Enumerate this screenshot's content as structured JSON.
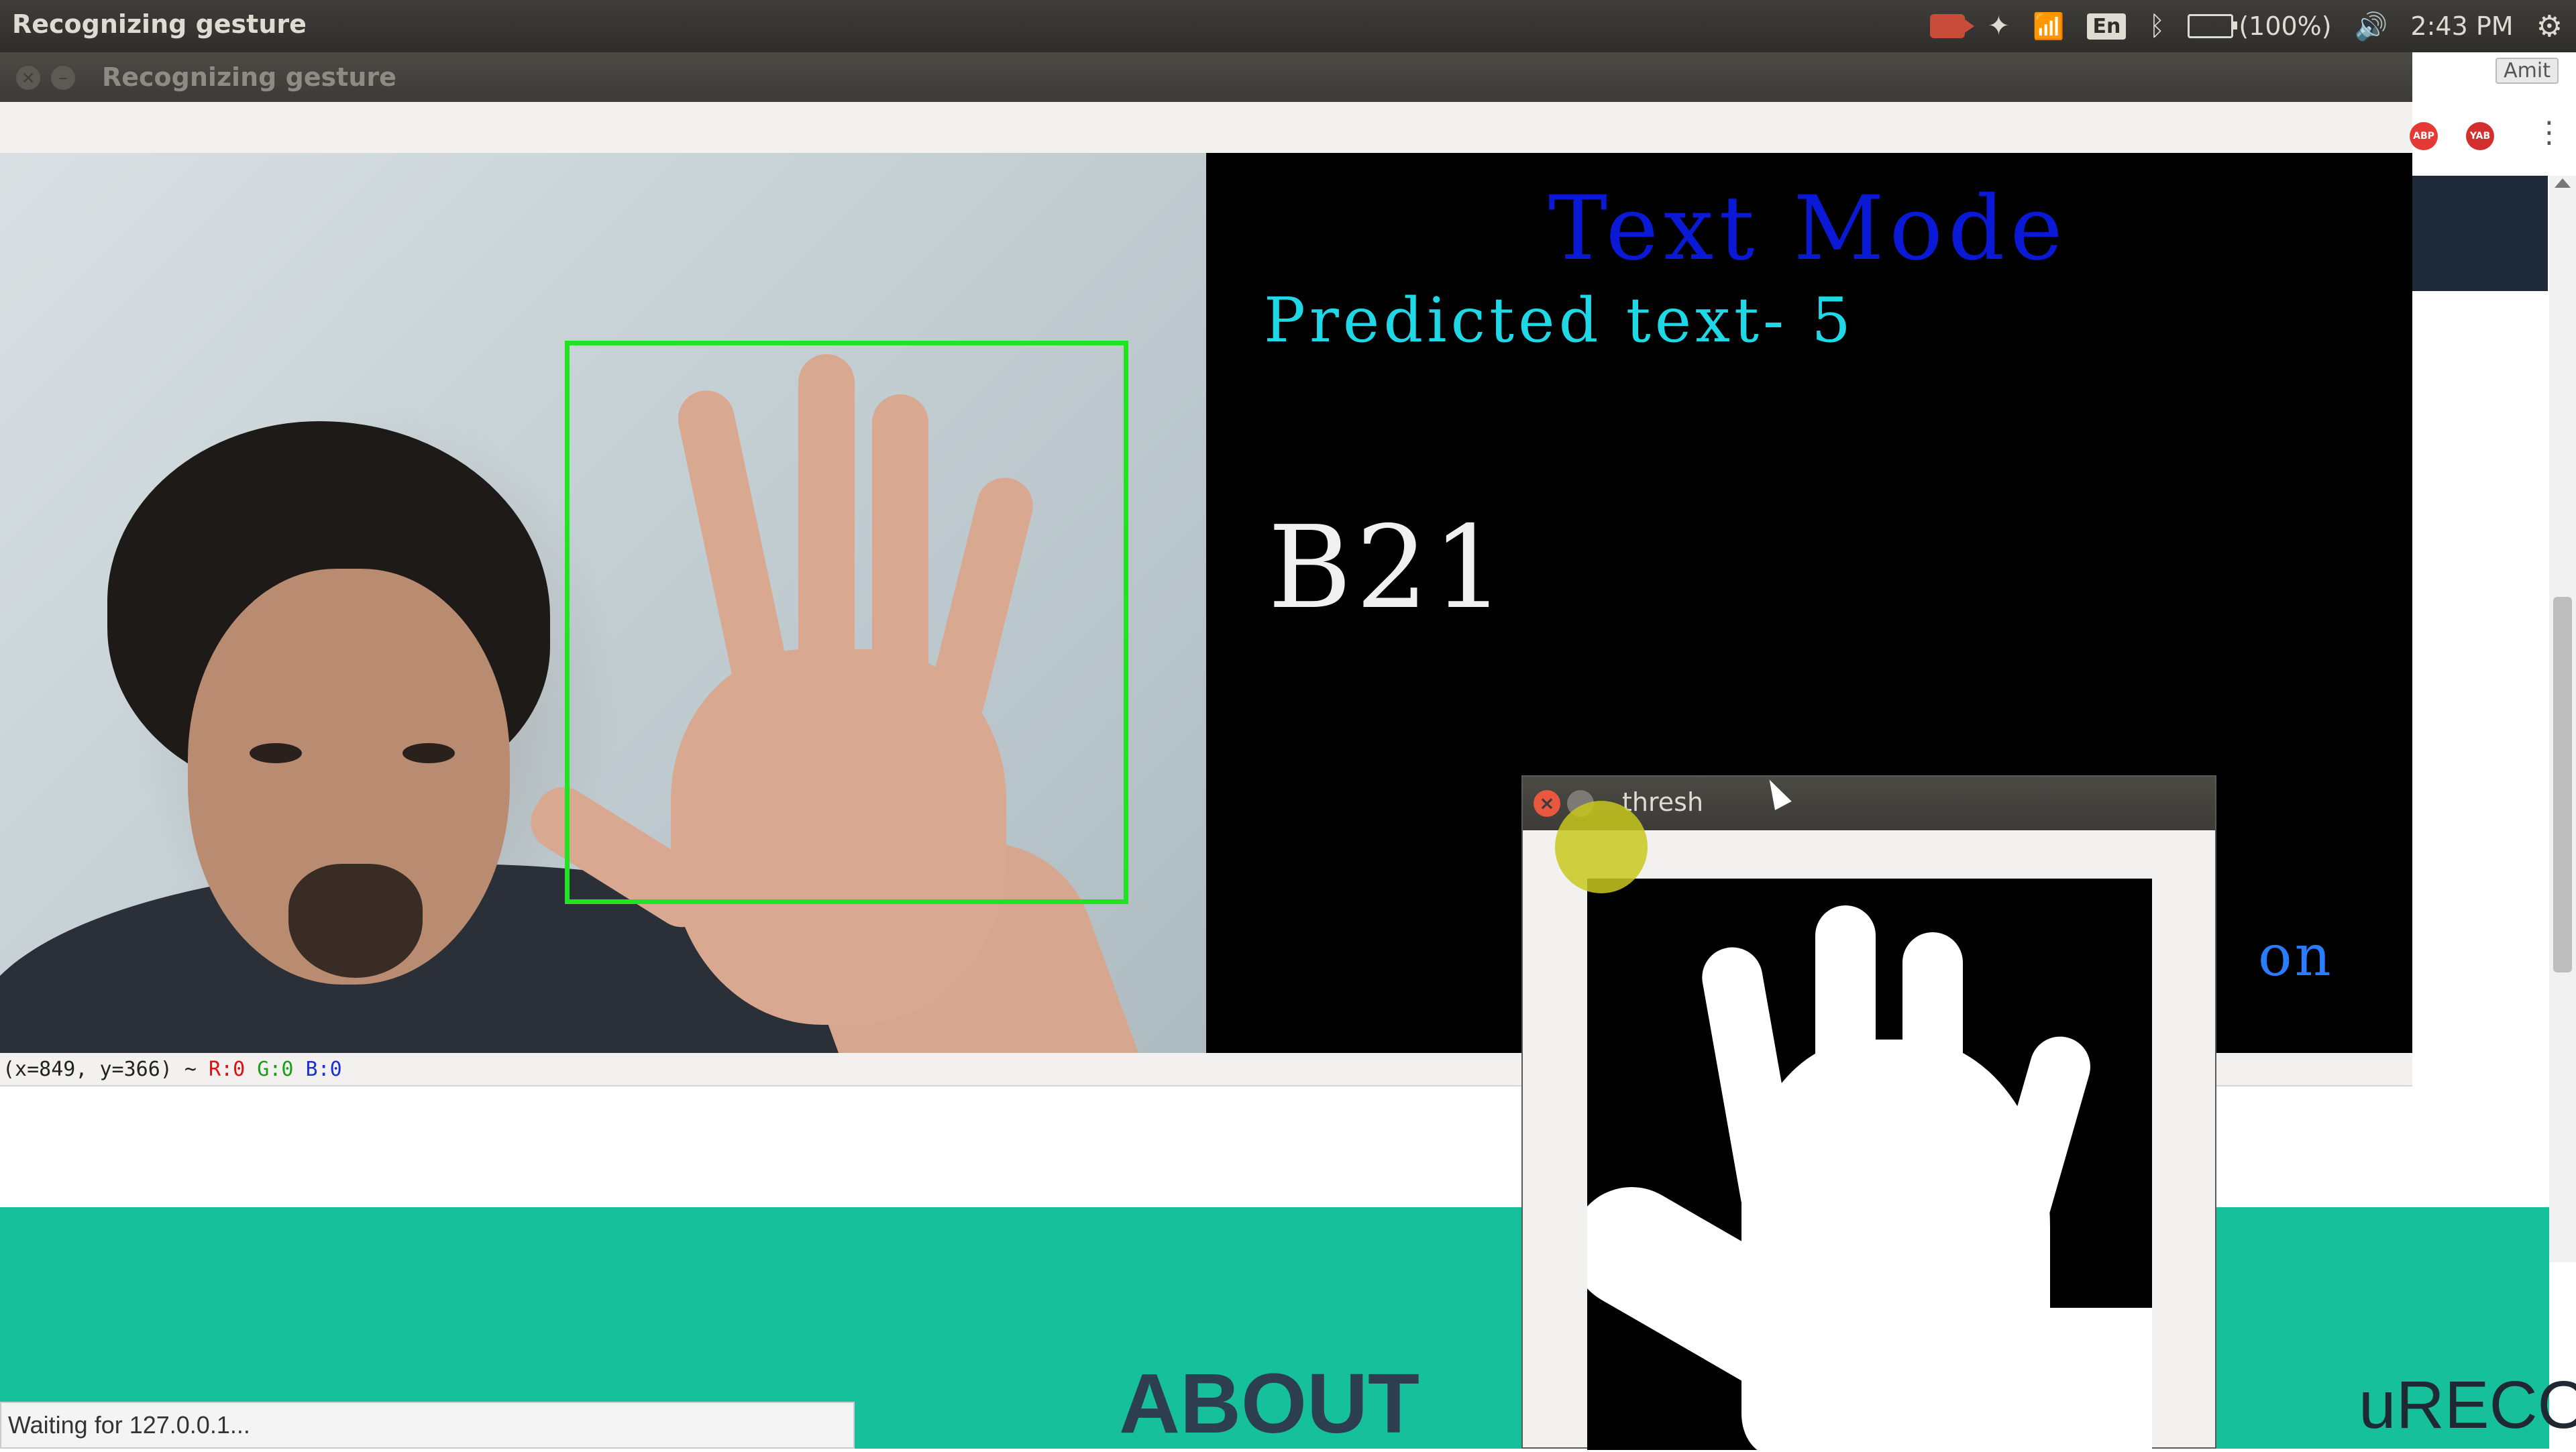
{
  "topbar": {
    "title": "Recognizing gesture",
    "language": "En",
    "battery": "(100%)",
    "clock": "2:43 PM",
    "icons": [
      "record-icon",
      "dropbox-icon",
      "wifi-icon",
      "keyboard-language-icon",
      "bluetooth-icon",
      "battery-icon",
      "volume-icon",
      "settings-gear-icon"
    ]
  },
  "main_window": {
    "title": "Recognizing gesture",
    "status": {
      "coords": "(x=849, y=366) ~",
      "r": "R:0",
      "g": "G:0",
      "b": "B:0"
    }
  },
  "text_mode": {
    "title": "Text Mode",
    "predicted": "Predicted text- 5",
    "word": "B21",
    "partial": "on"
  },
  "browser": {
    "user": "Amit",
    "ext1": "ABP",
    "ext2": "YAB",
    "status": "Waiting for 127.0.0.1...",
    "section_heading": "ABOUT",
    "brand": "uRECO"
  },
  "thresh_window": {
    "title": "thresh"
  },
  "colors": {
    "roi_box": "#22e322",
    "text_mode_title": "#0a19d6",
    "predicted_text": "#1fd8e6",
    "teal": "#16c09a"
  }
}
